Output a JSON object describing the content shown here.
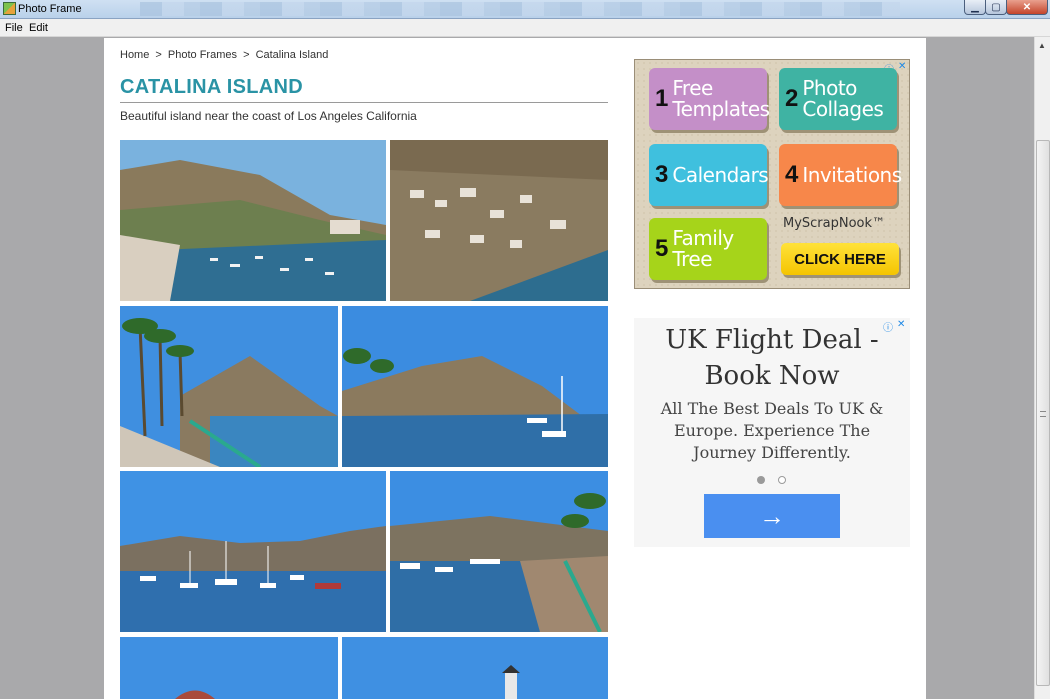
{
  "window": {
    "title": "Photo Frame",
    "minimize": "▁",
    "maximize": "▢",
    "close": "✕"
  },
  "menu": {
    "file": "File",
    "edit": "Edit"
  },
  "breadcrumb": {
    "home": "Home",
    "sep": ">",
    "photo_frames": "Photo Frames",
    "current": "Catalina Island"
  },
  "page": {
    "title": "CATALINA ISLAND",
    "description": "Beautiful island near the coast of Los Angeles California"
  },
  "photos": [
    {
      "name": "harbor-overview"
    },
    {
      "name": "town-hillside"
    },
    {
      "name": "palm-promenade"
    },
    {
      "name": "bay-with-boats"
    },
    {
      "name": "anchored-sailboats"
    },
    {
      "name": "pier-and-rocks"
    },
    {
      "name": "casino-dome"
    },
    {
      "name": "lighthouse-tower"
    }
  ],
  "ad1": {
    "tiles": [
      {
        "num": "1",
        "label": "Free Templates",
        "color": "#c48fc8"
      },
      {
        "num": "2",
        "label": "Photo Collages",
        "color": "#3fb3a3"
      },
      {
        "num": "3",
        "label": "Calendars",
        "color": "#3fc0de"
      },
      {
        "num": "4",
        "label": "Invitations",
        "color": "#f7874a"
      },
      {
        "num": "5",
        "label": "Family Tree",
        "color": "#a6d41a"
      }
    ],
    "brand": "MyScrapNook™",
    "cta": "CLICK HERE",
    "info_icon": "ⓘ",
    "close_icon": "✕"
  },
  "ad2": {
    "headline": "UK Flight Deal - Book Now",
    "body": "All The Best Deals To UK & Europe. Experience The Journey Differently.",
    "arrow": "→",
    "info_icon": "ⓘ",
    "close_icon": "✕",
    "button_color": "#4a8ff0"
  }
}
